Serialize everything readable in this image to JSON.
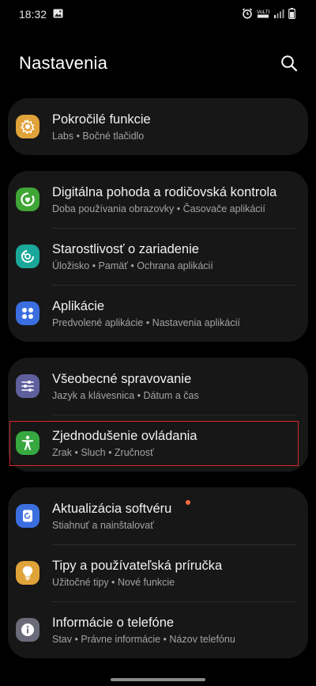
{
  "status_bar": {
    "time": "18:32"
  },
  "header": {
    "title": "Nastavenia"
  },
  "groups": [
    {
      "items": [
        {
          "title": "Pokročilé funkcie",
          "subtitle": "Labs • Bočné tlačidlo",
          "icon": "advanced-features-icon",
          "color": "#e0a33a"
        }
      ]
    },
    {
      "items": [
        {
          "title": "Digitálna pohoda a rodičovská kontrola",
          "subtitle": "Doba používania obrazovky • Časovače aplikácií",
          "icon": "digital-wellbeing-icon",
          "color": "#3fa535"
        },
        {
          "title": "Starostlivosť o zariadenie",
          "subtitle": "Úložisko • Pamäť • Ochrana aplikácií",
          "icon": "device-care-icon",
          "color": "#1ba89a"
        },
        {
          "title": "Aplikácie",
          "subtitle": "Predvolené aplikácie • Nastavenia aplikácií",
          "icon": "apps-icon",
          "color": "#3b6fe0"
        }
      ]
    },
    {
      "items": [
        {
          "title": "Všeobecné spravovanie",
          "subtitle": "Jazyk a klávesnica • Dátum a čas",
          "icon": "general-management-icon",
          "color": "#5f5f9e"
        },
        {
          "title": "Zjednodušenie ovládania",
          "subtitle": "Zrak • Sluch • Zručnosť",
          "icon": "accessibility-icon",
          "color": "#36a83f"
        }
      ]
    },
    {
      "items": [
        {
          "title": "Aktualizácia softvéru",
          "subtitle": "Stiahnuť a nainštalovať",
          "icon": "software-update-icon",
          "color": "#3b6fe0"
        },
        {
          "title": "Tipy a používateľská príručka",
          "subtitle": "Užitočné tipy • Nové funkcie",
          "icon": "tips-icon",
          "color": "#e0a33a"
        },
        {
          "title": "Informácie o telefóne",
          "subtitle": "Stav • Právne informácie • Názov telefónu",
          "icon": "about-phone-icon",
          "color": "#6b6b7a"
        }
      ]
    }
  ]
}
